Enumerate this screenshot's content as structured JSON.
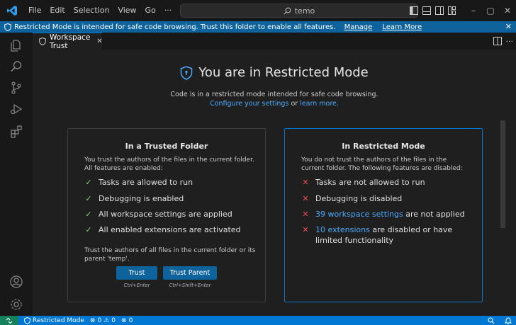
{
  "titlebar": {
    "menu": [
      "File",
      "Edit",
      "Selection",
      "View",
      "Go",
      "···"
    ],
    "search": "temo",
    "icons": [
      "vscode-logo",
      "back-arrow",
      "forward-arrow",
      "search-icon",
      "toggle-primary-sidebar",
      "toggle-panel",
      "toggle-secondary-sidebar",
      "customize-layout",
      "minimize",
      "maximize",
      "close"
    ]
  },
  "banner": {
    "text": "Restricted Mode is intended for safe code browsing. Trust this folder to enable all features.",
    "manage": "Manage",
    "learn_more": "Learn More"
  },
  "tab": {
    "label": "Workspace Trust"
  },
  "hero": {
    "title": "You are in Restricted Mode",
    "subtitle": "Code is in a restricted mode intended for safe code browsing.",
    "configure": "Configure your settings",
    "or": "or",
    "learn_more": "learn more."
  },
  "trusted": {
    "title": "In a Trusted Folder",
    "desc": "You trust the authors of the files in the current folder. All features are enabled:",
    "features": [
      "Tasks are allowed to run",
      "Debugging is enabled",
      "All workspace settings are applied",
      "All enabled extensions are activated"
    ],
    "note": "Trust the authors of all files in the current folder or its parent 'temp'.",
    "btn_trust": "Trust",
    "btn_trust_hint": "Ctrl+Enter",
    "btn_trust_parent": "Trust Parent",
    "btn_trust_parent_hint": "Ctrl+Shift+Enter"
  },
  "restricted": {
    "title": "In Restricted Mode",
    "desc": "You do not trust the authors of the files in the current folder. The following features are disabled:",
    "f1": "Tasks are not allowed to run",
    "f2": "Debugging is disabled",
    "f3_link": "39 workspace settings",
    "f3_rest": "are not applied",
    "f4_link": "10 extensions",
    "f4_rest": "are disabled or have limited functionality"
  },
  "status": {
    "mode": "Restricted Mode",
    "errors": "0",
    "warnings": "0",
    "ports": "0"
  },
  "colors": {
    "accent": "#0078d4",
    "banner": "#0e639c",
    "check": "#89d185",
    "cross": "#f14c4c",
    "link": "#4daafc"
  }
}
